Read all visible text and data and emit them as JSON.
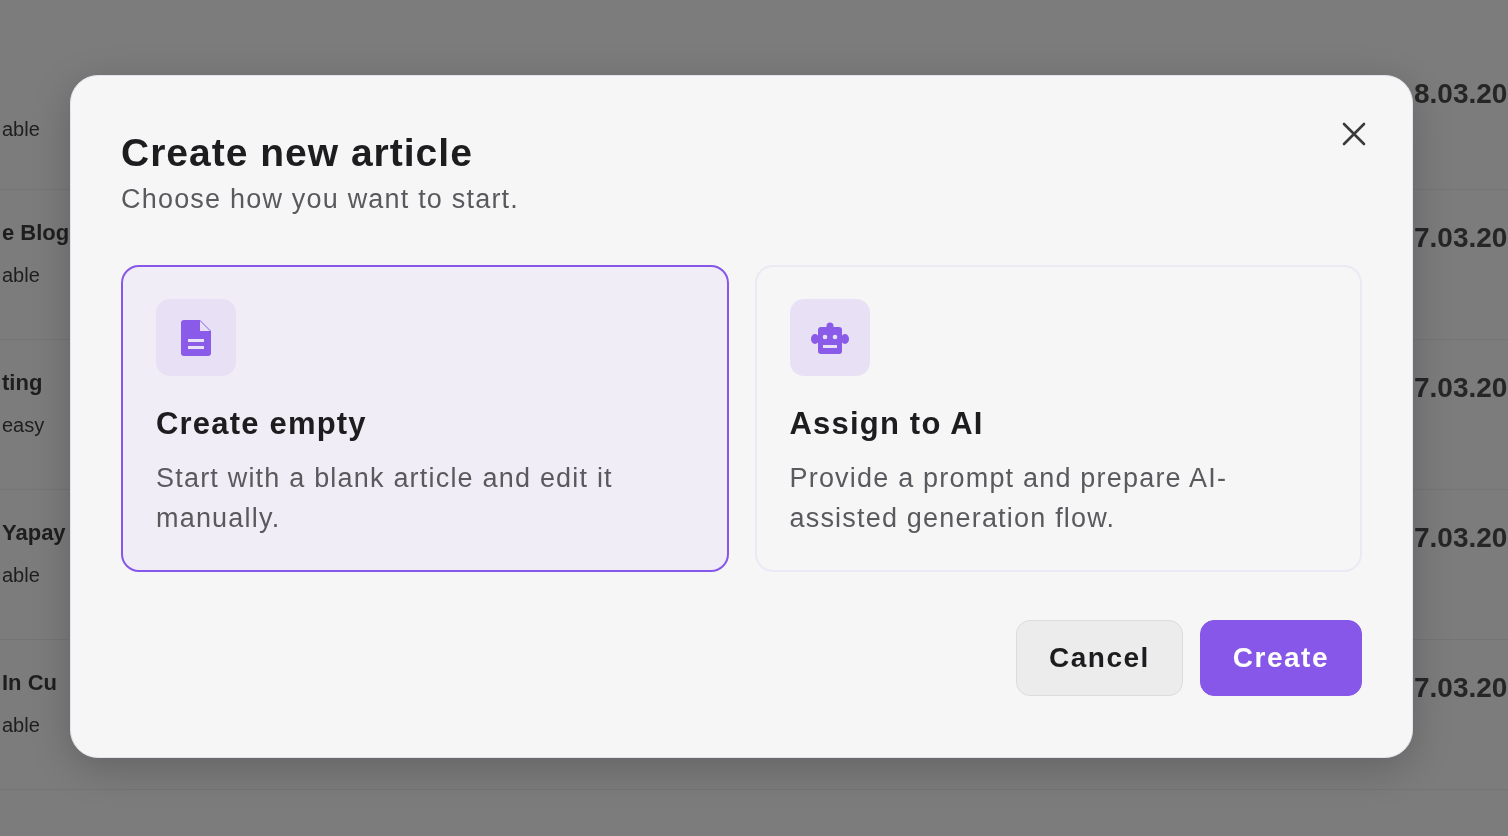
{
  "background_table": {
    "rows": [
      {
        "title": "",
        "subtitle": "able",
        "updated": "8.03.20"
      },
      {
        "title": "e Blog",
        "subtitle": "able",
        "updated": "7.03.20"
      },
      {
        "title": "ting",
        "subtitle": "easy",
        "updated": "7.03.20"
      },
      {
        "title": "Yapay",
        "subtitle": "able",
        "updated": "7.03.20"
      },
      {
        "title": "In Cu",
        "subtitle": "able",
        "updated": "7.03.20"
      }
    ]
  },
  "dialog": {
    "title": "Create new article",
    "subtitle": "Choose how you want to start.",
    "options": [
      {
        "kind": "document",
        "title": "Create empty",
        "description": "Start with a blank article and edit it manually.",
        "selected": true
      },
      {
        "kind": "robot",
        "title": "Assign to AI",
        "description": "Provide a prompt and prepare AI-assisted generation flow.",
        "selected": false
      }
    ],
    "buttons": [
      {
        "kind": "secondary",
        "label": "Cancel"
      },
      {
        "kind": "primary",
        "label": "Create"
      }
    ]
  }
}
